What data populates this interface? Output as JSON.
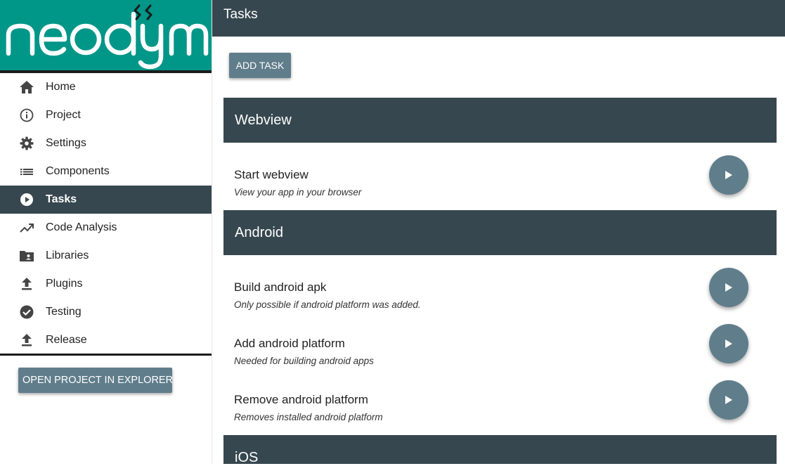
{
  "app": {
    "logo_text": "neodym",
    "brand_color": "#009688",
    "dark_color": "#37474f",
    "accent_button_color": "#607d8b"
  },
  "sidebar": {
    "items": [
      {
        "label": "Home",
        "icon": "home-icon",
        "active": false
      },
      {
        "label": "Project",
        "icon": "info-icon",
        "active": false
      },
      {
        "label": "Settings",
        "icon": "gear-icon",
        "active": false
      },
      {
        "label": "Components",
        "icon": "list-icon",
        "active": false
      },
      {
        "label": "Tasks",
        "icon": "play-circle-icon",
        "active": true
      },
      {
        "label": "Code Analysis",
        "icon": "trending-up-icon",
        "active": false
      },
      {
        "label": "Libraries",
        "icon": "folder-shared-icon",
        "active": false
      },
      {
        "label": "Plugins",
        "icon": "upload-icon",
        "active": false
      },
      {
        "label": "Testing",
        "icon": "check-circle-icon",
        "active": false
      },
      {
        "label": "Release",
        "icon": "upload-icon",
        "active": false
      }
    ],
    "open_project_label": "OPEN PROJECT IN EXPLORER"
  },
  "header": {
    "title": "Tasks"
  },
  "main": {
    "add_task_label": "ADD TASK",
    "sections": [
      {
        "title": "Webview",
        "tasks": [
          {
            "name": "Start webview",
            "description": "View your app in your browser"
          }
        ]
      },
      {
        "title": "Android",
        "tasks": [
          {
            "name": "Build android apk",
            "description": "Only possible if android platform was added."
          },
          {
            "name": "Add android platform",
            "description": "Needed for building android apps"
          },
          {
            "name": "Remove android platform",
            "description": "Removes installed android platform"
          }
        ]
      },
      {
        "title": "iOS",
        "tasks": []
      }
    ]
  }
}
